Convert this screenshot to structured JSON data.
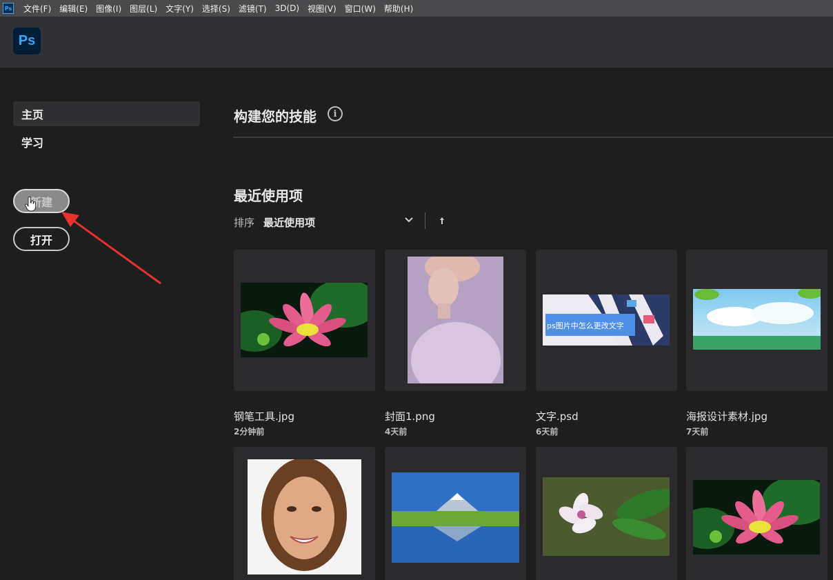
{
  "menubar": {
    "items": [
      "文件(F)",
      "编辑(E)",
      "图像(I)",
      "图层(L)",
      "文字(Y)",
      "选择(S)",
      "滤镜(T)",
      "3D(D)",
      "视图(V)",
      "窗口(W)",
      "帮助(H)"
    ]
  },
  "header": {
    "logo_text": "Ps"
  },
  "sidebar": {
    "nav": [
      {
        "label": "主页",
        "active": true
      },
      {
        "label": "学习",
        "active": false
      }
    ],
    "new_label": "新建",
    "open_label": "打开"
  },
  "main": {
    "skills_title": "构建您的技能",
    "info_icon_glyph": "i",
    "recent_title": "最近使用项",
    "sort": {
      "label": "排序",
      "value": "最近使用项"
    },
    "files": [
      {
        "name": "钢笔工具.jpg",
        "time": "2分钟前",
        "thumb": "lotus-icon"
      },
      {
        "name": "封面1.png",
        "time": "4天前",
        "thumb": "portrait-painting-icon"
      },
      {
        "name": "文字.psd",
        "time": "6天前",
        "thumb": "text-banner-icon"
      },
      {
        "name": "海报设计素材.jpg",
        "time": "7天前",
        "thumb": "sky-landscape-icon"
      },
      {
        "thumb": "face-portrait-icon"
      },
      {
        "thumb": "mountain-lake-icon"
      },
      {
        "thumb": "plumeria-icon"
      },
      {
        "thumb": "lotus-icon"
      }
    ],
    "banner_text": "ps图片中怎么更改文字"
  },
  "colors": {
    "accent": "#31a8ff",
    "annotation_arrow": "#e8322e"
  }
}
